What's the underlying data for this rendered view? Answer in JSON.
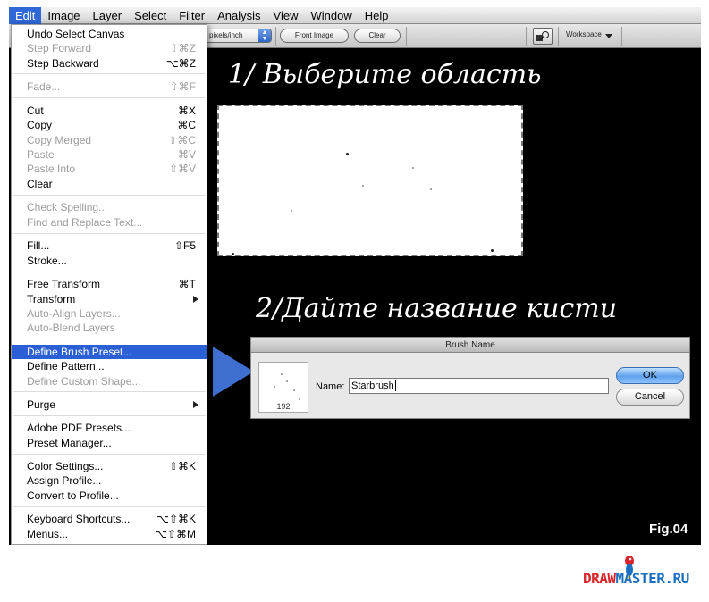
{
  "menubar": {
    "items": [
      "Edit",
      "Image",
      "Layer",
      "Select",
      "Filter",
      "Analysis",
      "View",
      "Window",
      "Help"
    ]
  },
  "options_bar": {
    "resolution_select": "pixels/inch",
    "front_image_button": "Front Image",
    "clear_button": "Clear",
    "workspace_label": "Workspace"
  },
  "edit_menu": {
    "items": [
      {
        "label": "Undo Select Canvas",
        "shortcut": "",
        "disabled": false
      },
      {
        "label": "Step Forward",
        "shortcut": "⇧⌘Z",
        "disabled": true
      },
      {
        "label": "Step Backward",
        "shortcut": "⌥⌘Z",
        "disabled": false
      },
      {
        "label": "Fade...",
        "shortcut": "⇧⌘F",
        "disabled": true
      },
      {
        "label": "Cut",
        "shortcut": "⌘X",
        "disabled": false
      },
      {
        "label": "Copy",
        "shortcut": "⌘C",
        "disabled": false
      },
      {
        "label": "Copy Merged",
        "shortcut": "⇧⌘C",
        "disabled": true
      },
      {
        "label": "Paste",
        "shortcut": "⌘V",
        "disabled": true
      },
      {
        "label": "Paste Into",
        "shortcut": "⇧⌘V",
        "disabled": true
      },
      {
        "label": "Clear",
        "shortcut": "",
        "disabled": false
      },
      {
        "label": "Check Spelling...",
        "shortcut": "",
        "disabled": true
      },
      {
        "label": "Find and Replace Text...",
        "shortcut": "",
        "disabled": true
      },
      {
        "label": "Fill...",
        "shortcut": "⇧F5",
        "disabled": false
      },
      {
        "label": "Stroke...",
        "shortcut": "",
        "disabled": false
      },
      {
        "label": "Free Transform",
        "shortcut": "⌘T",
        "disabled": false
      },
      {
        "label": "Transform",
        "shortcut": "",
        "disabled": false
      },
      {
        "label": "Auto-Align Layers...",
        "shortcut": "",
        "disabled": true
      },
      {
        "label": "Auto-Blend Layers",
        "shortcut": "",
        "disabled": true
      },
      {
        "label": "Define Brush Preset...",
        "shortcut": "",
        "disabled": false
      },
      {
        "label": "Define Pattern...",
        "shortcut": "",
        "disabled": false
      },
      {
        "label": "Define Custom Shape...",
        "shortcut": "",
        "disabled": true
      },
      {
        "label": "Purge",
        "shortcut": "",
        "disabled": false
      },
      {
        "label": "Adobe PDF Presets...",
        "shortcut": "",
        "disabled": false
      },
      {
        "label": "Preset Manager...",
        "shortcut": "",
        "disabled": false
      },
      {
        "label": "Color Settings...",
        "shortcut": "⇧⌘K",
        "disabled": false
      },
      {
        "label": "Assign Profile...",
        "shortcut": "",
        "disabled": false
      },
      {
        "label": "Convert to Profile...",
        "shortcut": "",
        "disabled": false
      },
      {
        "label": "Keyboard Shortcuts...",
        "shortcut": "⌥⇧⌘K",
        "disabled": false
      },
      {
        "label": "Menus...",
        "shortcut": "⌥⇧⌘M",
        "disabled": false
      }
    ]
  },
  "canvas": {
    "step1": "1/ Выберите область",
    "step2": "2/Дайте название кисти",
    "fig_label": "Fig.04"
  },
  "brush_dialog": {
    "title": "Brush Name",
    "preview_size": "192",
    "name_label": "Name:",
    "name_value": "Starbrush",
    "ok": "OK",
    "cancel": "Cancel"
  },
  "logo": {
    "draw": "DRAW",
    "master": "MASTER.RU"
  },
  "colors": {
    "menu_highlight": "#2a5fd6",
    "arrow": "#3f6fd0",
    "logo_red": "#d8232a",
    "logo_blue": "#1b6fc0"
  }
}
